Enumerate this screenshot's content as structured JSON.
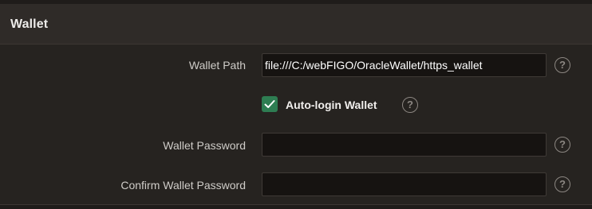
{
  "section": {
    "title": "Wallet"
  },
  "fields": {
    "wallet_path": {
      "label": "Wallet Path",
      "value": "file:///C:/webFIGO/OracleWallet/https_wallet"
    },
    "auto_login": {
      "label": "Auto-login Wallet",
      "checked": true
    },
    "wallet_password": {
      "label": "Wallet Password",
      "value": ""
    },
    "confirm_wallet_password": {
      "label": "Confirm Wallet Password",
      "value": ""
    }
  },
  "help": {
    "glyph": "?"
  },
  "colors": {
    "checkbox_accent": "#2e7d52",
    "background": "#262320",
    "header_background": "#2f2b28"
  }
}
